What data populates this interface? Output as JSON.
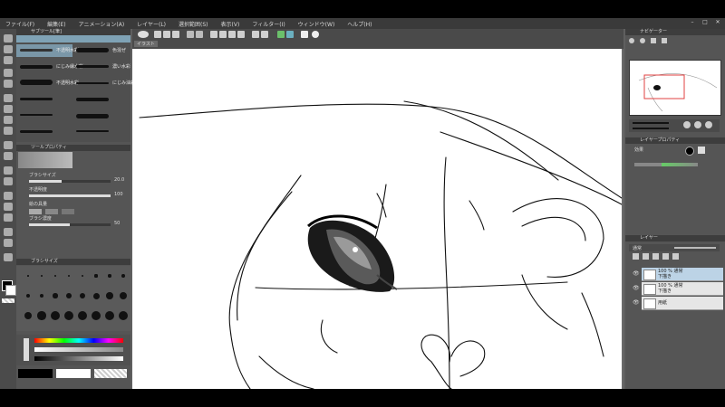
{
  "menu": {
    "items": [
      "ファイル(F)",
      "編集(E)",
      "アニメーション(A)",
      "レイヤー(L)",
      "選択範囲(S)",
      "表示(V)",
      "フィルター(I)",
      "ウィンドウ(W)",
      "ヘルプ(H)"
    ]
  },
  "canvas": {
    "tab_label": "イラスト"
  },
  "tool_property": {
    "title": "ツールプロパティ"
  },
  "brush_list": {
    "title": "サブツール[筆]",
    "items": [
      {
        "label": "不透明水彩"
      },
      {
        "label": "色混ぜ"
      },
      {
        "label": "にじみ縁水彩"
      },
      {
        "label": "濃い水彩"
      },
      {
        "label": "不透明水彩"
      },
      {
        "label": "にじみ油彩"
      }
    ]
  },
  "properties": {
    "size_label": "ブラシサイズ",
    "size_value": "20.0",
    "opacity_label": "不透明度",
    "opacity_value": "100",
    "color_label": "絵の具量",
    "density_label": "ブラシ濃度",
    "density_value": "50"
  },
  "brush_size": {
    "title": "ブラシサイズ"
  },
  "right": {
    "navigator_title": "ナビゲーター",
    "layer_property_title": "レイヤープロパティ",
    "effect_label": "効果",
    "layer_title": "レイヤー",
    "blend_mode": "通常",
    "layers": [
      {
        "name": "100 % 通常",
        "sub": "下描き"
      },
      {
        "name": "100 % 通常",
        "sub": "下描き"
      },
      {
        "name": "用紙",
        "sub": ""
      }
    ]
  },
  "colors": {
    "accent": "#e04040",
    "paper": "#ffffff",
    "ui_dark": "#3a3a3a",
    "ui_mid": "#5f5f5f"
  }
}
